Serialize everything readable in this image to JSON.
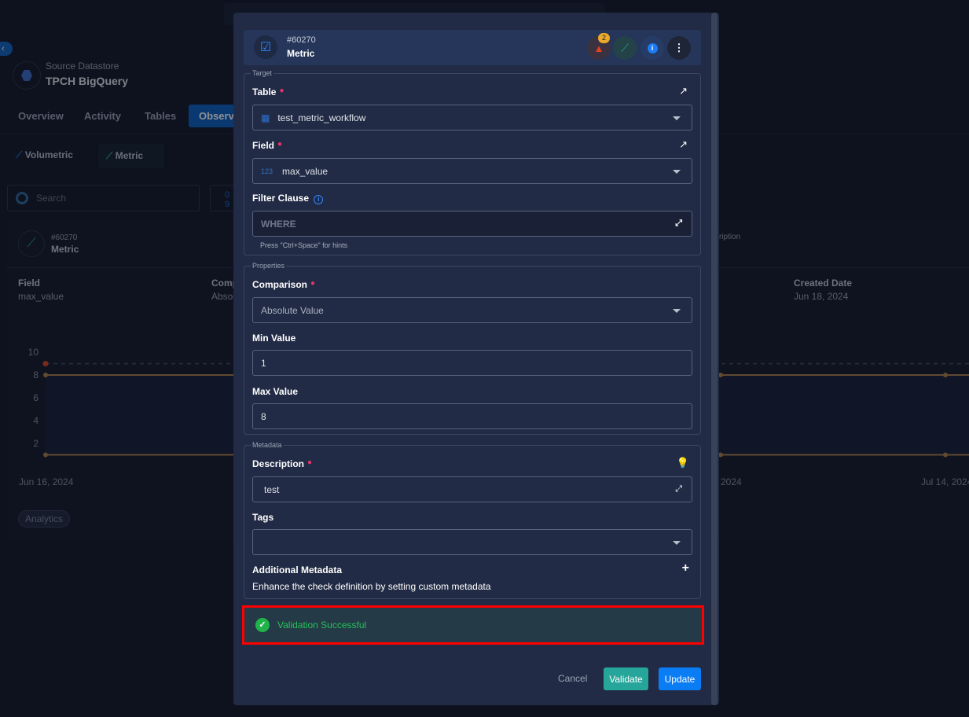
{
  "background": {
    "datastore_label": "Source Datastore",
    "datastore_name": "TPCH BigQuery",
    "tabs": [
      "Overview",
      "Activity",
      "Tables",
      "Observa"
    ],
    "subtabs": [
      "Volumetric",
      "Metric"
    ],
    "search_placeholder": "Search",
    "card": {
      "id": "#60270",
      "type": "Metric",
      "field_label": "Field",
      "field_value": "max_value",
      "comparison_label": "Comp",
      "comparison_value": "Abso",
      "description_label": "ription",
      "created_label": "Created Date",
      "created_value": "Jun 18, 2024",
      "tag": "Analytics"
    }
  },
  "chart_data": {
    "type": "line",
    "y_ticks": [
      "10",
      "8",
      "6",
      "4",
      "2"
    ],
    "x_ticks": [
      "Jun 16, 2024",
      "2024",
      "Jul 14, 2024"
    ],
    "ylim": [
      0,
      10
    ],
    "series": [
      {
        "values": [
          8,
          8,
          8
        ]
      },
      {
        "values": [
          1,
          1,
          1
        ]
      }
    ],
    "anomaly_point": 9,
    "colors": {
      "threshold": "#a9804a",
      "anomaly": "#d9481f"
    }
  },
  "modal": {
    "id": "#60270",
    "type": "Metric",
    "alert_count": "2",
    "target_legend": "Target",
    "table_label": "Table",
    "table_value": "test_metric_workflow",
    "field_label": "Field",
    "field_type": "123",
    "field_value": "max_value",
    "filter_label": "Filter Clause",
    "filter_placeholder": "WHERE",
    "filter_hint": "Press \"Ctrl+Space\" for hints",
    "properties_legend": "Properties",
    "comparison_label": "Comparison",
    "comparison_value": "Absolute Value",
    "min_label": "Min Value",
    "min_value": "1",
    "max_label": "Max Value",
    "max_value": "8",
    "metadata_legend": "Metadata",
    "description_label": "Description",
    "description_value": "test",
    "tags_label": "Tags",
    "additional_label": "Additional Metadata",
    "additional_desc": "Enhance the check definition by setting custom metadata",
    "validation_message": "Validation Successful",
    "cancel": "Cancel",
    "validate": "Validate",
    "update": "Update"
  }
}
